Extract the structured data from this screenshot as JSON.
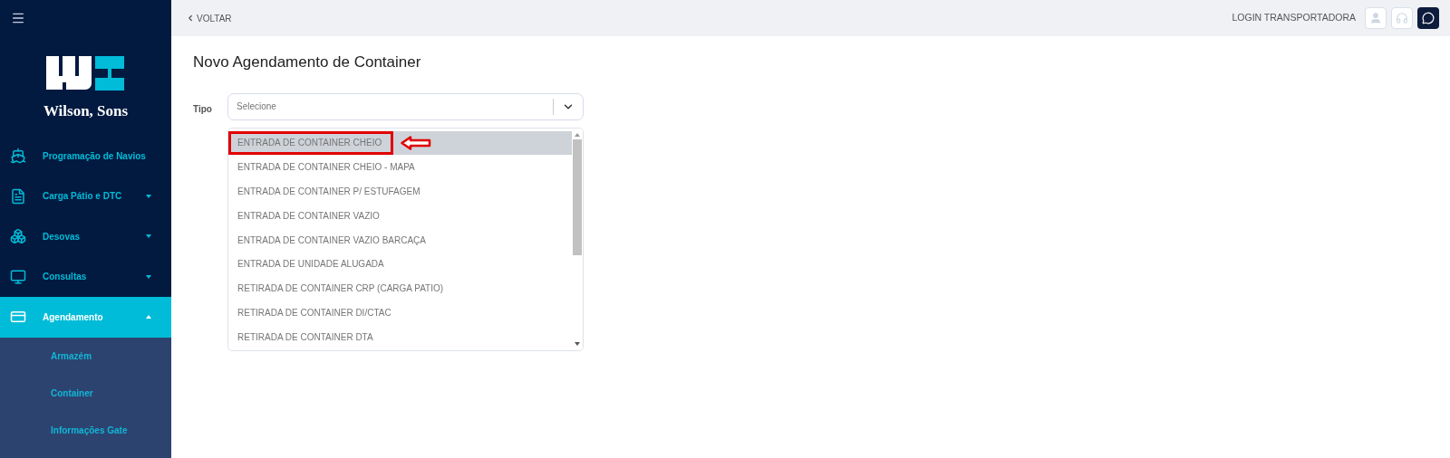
{
  "sidebar": {
    "brand": "Wilson, Sons",
    "items": [
      {
        "label": "Programação de Navios",
        "expandable": false,
        "selected": false
      },
      {
        "label": "Carga Pátio e DTC",
        "expandable": true,
        "expanded": false,
        "selected": false
      },
      {
        "label": "Desovas",
        "expandable": true,
        "expanded": false,
        "selected": false
      },
      {
        "label": "Consultas",
        "expandable": true,
        "expanded": false,
        "selected": false
      },
      {
        "label": "Agendamento",
        "expandable": true,
        "expanded": true,
        "selected": true,
        "children": [
          {
            "label": "Armazém"
          },
          {
            "label": "Container"
          },
          {
            "label": "Informações Gate"
          }
        ]
      }
    ]
  },
  "topbar": {
    "back": "VOLTAR",
    "user": "LOGIN TRANSPORTADORA"
  },
  "page": {
    "title": "Novo Agendamento de Container",
    "field": {
      "label": "Tipo",
      "placeholder": "Selecione",
      "expanded": true
    },
    "options": [
      {
        "label": "ENTRADA DE CONTAINER CHEIO",
        "selected": true,
        "annotated": true
      },
      {
        "label": "ENTRADA DE CONTAINER CHEIO - MAPA",
        "selected": false,
        "annotated": false
      },
      {
        "label": "ENTRADA DE CONTAINER P/ ESTUFAGEM",
        "selected": false,
        "annotated": false
      },
      {
        "label": "ENTRADA DE CONTAINER VAZIO",
        "selected": false,
        "annotated": false
      },
      {
        "label": "ENTRADA DE CONTAINER VAZIO BARCAÇA",
        "selected": false,
        "annotated": false
      },
      {
        "label": "ENTRADA DE UNIDADE ALUGADA",
        "selected": false,
        "annotated": false
      },
      {
        "label": "RETIRADA DE CONTAINER CRP (CARGA PATIO)",
        "selected": false,
        "annotated": false
      },
      {
        "label": "RETIRADA DE CONTAINER DI/CTAC",
        "selected": false,
        "annotated": false
      },
      {
        "label": "RETIRADA DE CONTAINER DTA",
        "selected": false,
        "annotated": false
      }
    ]
  }
}
